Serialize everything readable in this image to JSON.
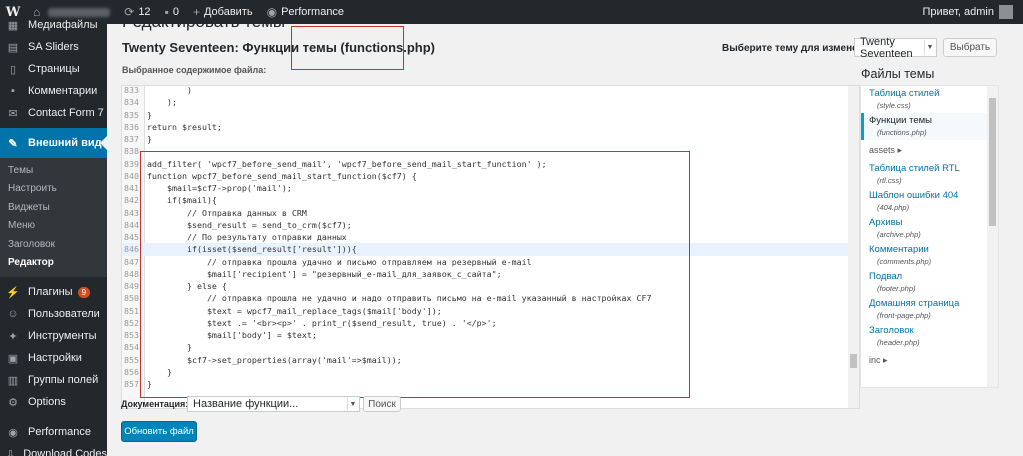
{
  "admin_bar": {
    "updates_count": "12",
    "comments_count": "0",
    "add_new": "Добавить",
    "performance": "Performance",
    "greeting": "Привет, admin"
  },
  "sidebar": {
    "items_top": [
      {
        "label": "Медиафайлы",
        "icon": "media-icon"
      },
      {
        "label": "SA Sliders",
        "icon": "slider-icon"
      },
      {
        "label": "Страницы",
        "icon": "pages-icon"
      },
      {
        "label": "Комментарии",
        "icon": "comments-icon"
      },
      {
        "label": "Contact Form 7",
        "icon": "mail-icon"
      }
    ],
    "active": {
      "label": "Внешний вид",
      "icon": "paintbrush-icon"
    },
    "submenu": [
      "Темы",
      "Настроить",
      "Виджеты",
      "Меню",
      "Заголовок",
      "Редактор"
    ],
    "items_bottom": [
      {
        "label": "Плагины",
        "icon": "plugins-icon",
        "badge": "9"
      },
      {
        "label": "Пользователи",
        "icon": "users-icon"
      },
      {
        "label": "Инструменты",
        "icon": "tools-icon"
      },
      {
        "label": "Настройки",
        "icon": "settings-icon"
      },
      {
        "label": "Группы полей",
        "icon": "fields-icon"
      },
      {
        "label": "Options",
        "icon": "options-icon"
      },
      {
        "label": "Performance",
        "icon": "performance-icon"
      },
      {
        "label": "Download Codes",
        "icon": "download-icon"
      }
    ]
  },
  "header": {
    "page_title": "Редактировать темы",
    "file_title": "Twenty Seventeen: Функции темы (functions.php)",
    "theme_select_label": "Выберите тему для изменения:",
    "theme_selected": "Twenty Seventeen",
    "select_button": "Выбрать",
    "selected_content_label": "Выбранное содержимое файла:"
  },
  "editor": {
    "lines": [
      {
        "n": "833",
        "text": "        )"
      },
      {
        "n": "834",
        "text": "    );"
      },
      {
        "n": "835",
        "text": "}"
      },
      {
        "n": "836",
        "text": "return $result;"
      },
      {
        "n": "837",
        "text": "}"
      },
      {
        "n": "838",
        "text": ""
      },
      {
        "n": "839",
        "text": "add_filter( 'wpcf7_before_send_mail', 'wpcf7_before_send_mail_start_function' );"
      },
      {
        "n": "840",
        "text": "function wpcf7_before_send_mail_start_function($cf7) {"
      },
      {
        "n": "841",
        "text": "    $mail=$cf7->prop('mail');"
      },
      {
        "n": "842",
        "text": "    if($mail){"
      },
      {
        "n": "843",
        "text": "        // Отправка данных в CRM"
      },
      {
        "n": "844",
        "text": "        $send_result = send_to_crm($cf7);"
      },
      {
        "n": "845",
        "text": "        // По результату отправки данных"
      },
      {
        "n": "846",
        "text": "        if(isset($send_result['result'])){"
      },
      {
        "n": "847",
        "text": "            // отправка прошла удачно и письмо отправляем на резервный e-mail"
      },
      {
        "n": "848",
        "text": "            $mail['recipient'] = \"резервный_e-mail_для_заявок_с_сайта\";"
      },
      {
        "n": "849",
        "text": "        } else {"
      },
      {
        "n": "850",
        "text": "            // отправка прошла не удачно и надо отправить письмо на e-mail указанный в настройках CF7"
      },
      {
        "n": "851",
        "text": "            $text = wpcf7_mail_replace_tags($mail['body']);"
      },
      {
        "n": "852",
        "text": "            $text .= '<br><p>' . print_r($send_result, true) . '</p>';"
      },
      {
        "n": "853",
        "text": "            $mail['body'] = $text;"
      },
      {
        "n": "854",
        "text": "        }"
      },
      {
        "n": "855",
        "text": "        $cf7->set_properties(array('mail'=>$mail));"
      },
      {
        "n": "856",
        "text": "    }"
      },
      {
        "n": "857",
        "text": "}"
      }
    ]
  },
  "docs": {
    "label": "Документация:",
    "select_value": "Название функции...",
    "search_button": "Поиск",
    "update_button": "Обновить файл"
  },
  "files": {
    "title": "Файлы темы",
    "entries": [
      {
        "type": "file",
        "name": "Таблица стилей",
        "path": "(style.css)"
      },
      {
        "type": "file",
        "name": "Функции темы",
        "path": "(functions.php)",
        "current": true
      },
      {
        "type": "folder",
        "name": "assets ▸"
      },
      {
        "type": "file",
        "name": "Таблица стилей RTL",
        "path": "(rtl.css)"
      },
      {
        "type": "file",
        "name": "Шаблон ошибки 404",
        "path": "(404.php)"
      },
      {
        "type": "file",
        "name": "Архивы",
        "path": "(archive.php)"
      },
      {
        "type": "file",
        "name": "Комментарии",
        "path": "(comments.php)"
      },
      {
        "type": "file",
        "name": "Подвал",
        "path": "(footer.php)"
      },
      {
        "type": "file",
        "name": "Домашняя страница",
        "path": "(front-page.php)"
      },
      {
        "type": "file",
        "name": "Заголовок",
        "path": "(header.php)"
      },
      {
        "type": "folder",
        "name": "inc ▸"
      }
    ]
  },
  "colors": {
    "admin_bar_bg": "#23282d",
    "accent": "#0073aa",
    "primary_button": "#0085ba",
    "annotation_box": "#c43131"
  }
}
